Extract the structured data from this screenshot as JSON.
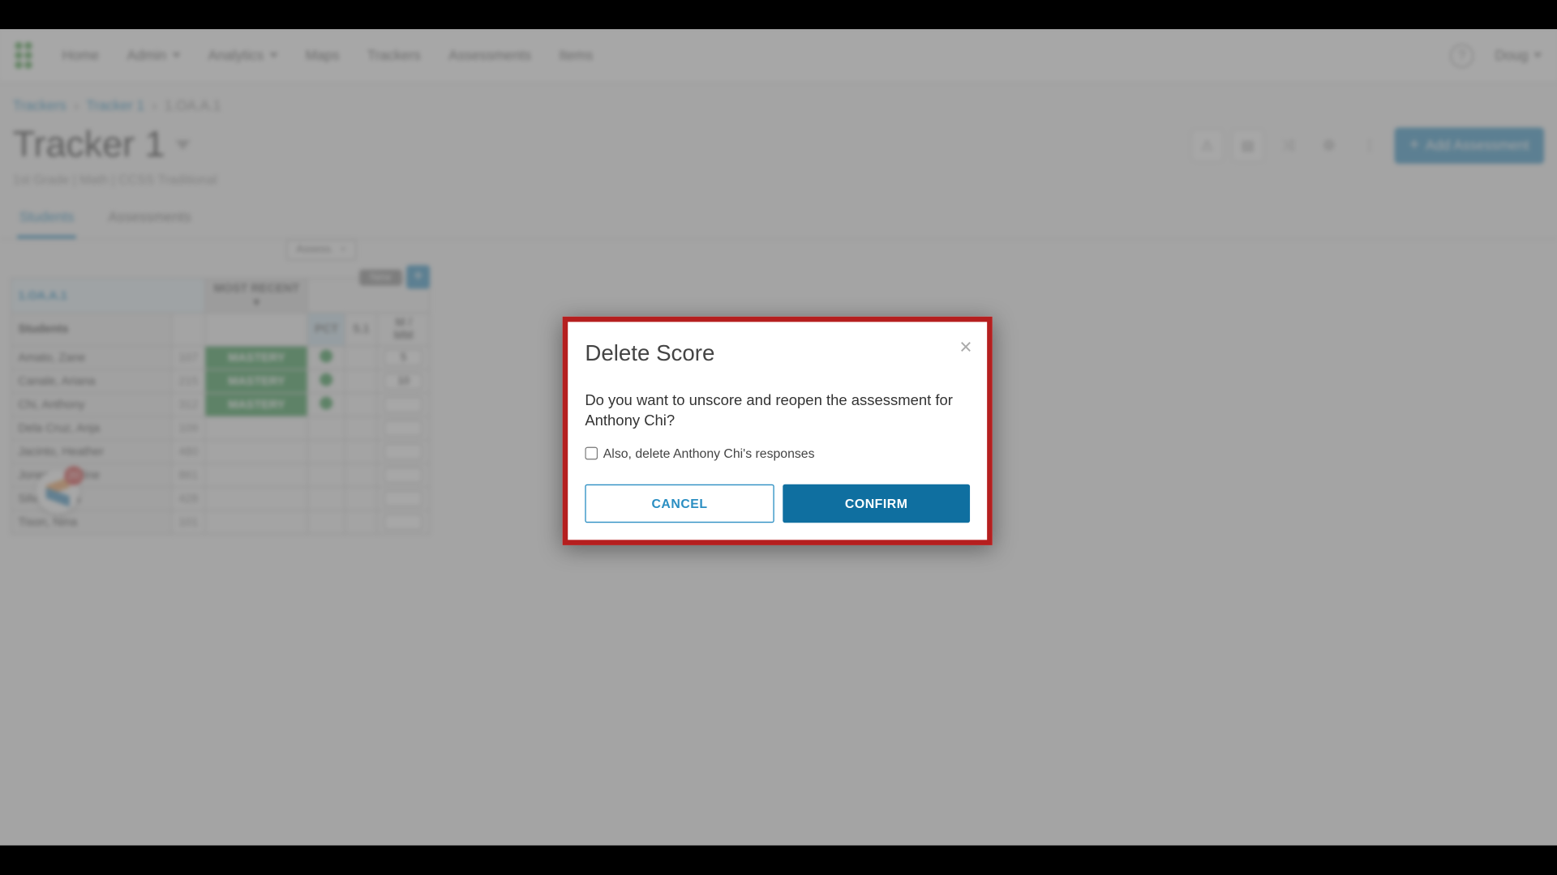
{
  "nav": {
    "items": [
      "Home",
      "Admin",
      "Analytics",
      "Maps",
      "Trackers",
      "Assessments",
      "Items"
    ],
    "dropdown_flags": [
      false,
      true,
      true,
      false,
      false,
      false,
      false
    ],
    "user": "Doug"
  },
  "breadcrumbs": {
    "a": "Trackers",
    "b": "Tracker 1",
    "c": "1.OA.A.1"
  },
  "page": {
    "title": "Tracker 1",
    "subtitle": "1st Grade | Math | CCSS Traditional",
    "add_button": "Add Assessment"
  },
  "tabs": {
    "students": "Students",
    "assessments": "Assessments"
  },
  "table": {
    "standard": "1.OA.A.1",
    "mastery_header": "MOST RECENT",
    "students_header": "Students",
    "assess_tab_label": "Assess.",
    "new_label": "New",
    "header_row2": {
      "pct": "PCT",
      "val": "5.1",
      "m": "M",
      "mm": "MM"
    },
    "rows": [
      {
        "name": "Amato, Zane",
        "id": "107",
        "mastery": "MASTERY",
        "dot": true,
        "input": "5"
      },
      {
        "name": "Canale, Ariana",
        "id": "215",
        "mastery": "MASTERY",
        "dot": true,
        "input": "10"
      },
      {
        "name": "Chi, Anthony",
        "id": "312",
        "mastery": "MASTERY",
        "dot": true,
        "input": ""
      },
      {
        "name": "Dela Cruz, Anja",
        "id": "109",
        "mastery": "",
        "dot": false,
        "input": ""
      },
      {
        "name": "Jacinto, Heather",
        "id": "480",
        "mastery": "",
        "dot": false,
        "input": ""
      },
      {
        "name": "Jones, Caroline",
        "id": "861",
        "mastery": "",
        "dot": false,
        "input": ""
      },
      {
        "name": "Silva, Amira",
        "id": "428",
        "mastery": "",
        "dot": false,
        "input": ""
      },
      {
        "name": "Tison, Nina",
        "id": "101",
        "mastery": "",
        "dot": false,
        "input": ""
      }
    ]
  },
  "badge": {
    "count": "20"
  },
  "modal": {
    "title": "Delete Score",
    "body": "Do you want to unscore and reopen the assessment for Anthony Chi?",
    "checkbox": "Also, delete Anthony Chi's responses",
    "cancel": "CANCEL",
    "confirm": "CONFIRM"
  }
}
